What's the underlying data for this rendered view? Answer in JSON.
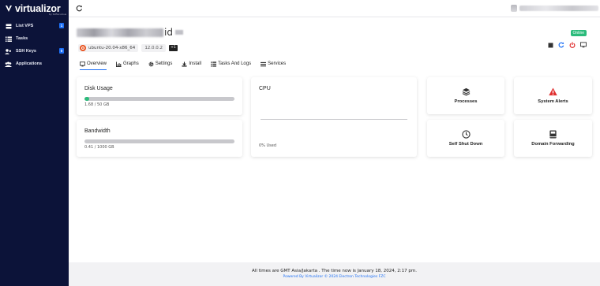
{
  "brand": {
    "name": "virtualizor",
    "tagline": "by Softaculous"
  },
  "sidebar": {
    "items": [
      {
        "label": "List VPS",
        "icon": "server-icon",
        "badge": "1"
      },
      {
        "label": "Tasks",
        "icon": "tasks-icon",
        "badge": ""
      },
      {
        "label": "SSH Keys",
        "icon": "key-icon",
        "badge": "0"
      },
      {
        "label": "Applications",
        "icon": "apps-icon",
        "badge": ""
      }
    ]
  },
  "vps": {
    "title_suffix": "id",
    "status": "Online",
    "os": "ubuntu-20.04-x86_64",
    "ip": "12.0.0.2",
    "extra_ips": "+1"
  },
  "tabs": [
    {
      "label": "Overview",
      "icon": "monitor-icon",
      "active": true
    },
    {
      "label": "Graphs",
      "icon": "chart-icon"
    },
    {
      "label": "Settings",
      "icon": "gear-icon"
    },
    {
      "label": "Install",
      "icon": "download-icon"
    },
    {
      "label": "Tasks And Logs",
      "icon": "list-icon"
    },
    {
      "label": "Services",
      "icon": "menu-icon"
    }
  ],
  "disk": {
    "title": "Disk Usage",
    "usage_text": "1.68 / 50 GB",
    "fraction": 0.034
  },
  "bandwidth": {
    "title": "Bandwidth",
    "usage_text": "0.41 / 1000 GB",
    "fraction": 0.0004
  },
  "cpu": {
    "title": "CPU",
    "used_text": "0% Used"
  },
  "tiles": {
    "processes": "Processes",
    "system_alerts": "System Alerts",
    "self_shut_down": "Self Shut Down",
    "domain_forwarding": "Domain Forwarding"
  },
  "footer": {
    "line1": "All times are GMT Asia/Jakarta . The time now is January 18, 2024, 2:17 pm.",
    "line2": "Powered By Virtualizor © 2024 Electron Technologies FZC"
  },
  "colors": {
    "sidebar": "#0c1339",
    "accent": "#1d6ff5",
    "online": "#2bbb7b",
    "danger": "#e02f2f"
  }
}
